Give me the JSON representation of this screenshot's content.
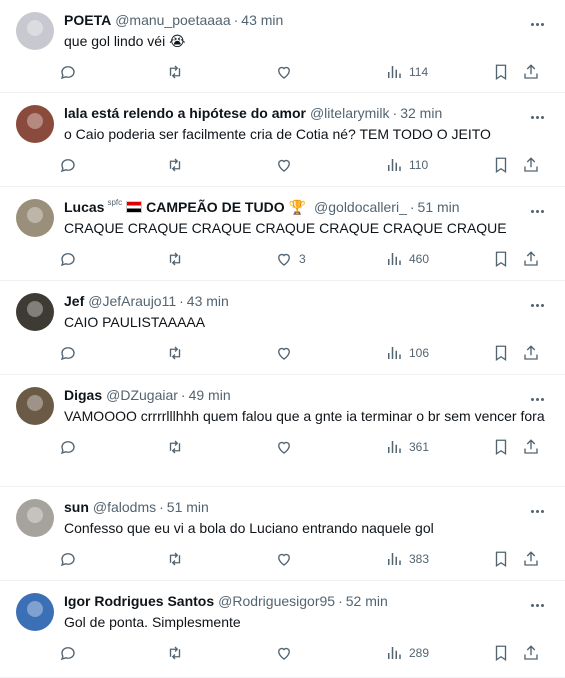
{
  "tweets": [
    {
      "name": "POETA",
      "handle": "@manu_poetaaaa",
      "time": "43 min",
      "text": "que gol lindo véi 😭",
      "replies": "",
      "retweets": "",
      "likes": "",
      "views": "114",
      "avatar_color": "#c8c8d0"
    },
    {
      "name": "lala está relendo a hipótese do amor",
      "handle": "@litelarymilk",
      "time": "32 min",
      "text": "o Caio poderia ser facilmente cria de Cotia né? TEM TODO O JEITO",
      "replies": "",
      "retweets": "",
      "likes": "",
      "views": "110",
      "avatar_color": "#8a4a3c"
    },
    {
      "name": "Lucas",
      "name_sup": "spfc",
      "name_suffix": "CAMPEÃO DE TUDO",
      "handle": "@goldocalleri_",
      "time": "51 min",
      "text": "CRAQUE CRAQUE CRAQUE CRAQUE CRAQUE CRAQUE CRAQUE",
      "replies": "",
      "retweets": "",
      "likes": "3",
      "views": "460",
      "avatar_color": "#9a8f7a"
    },
    {
      "name": "Jef",
      "handle": "@JefAraujo11",
      "time": "43 min",
      "text": "CAIO PAULISTAAAAA",
      "replies": "",
      "retweets": "",
      "likes": "",
      "views": "106",
      "avatar_color": "#3d3b33"
    },
    {
      "name": "Digas",
      "handle": "@DZugaiar",
      "time": "49 min",
      "text": "VAMOOOO crrrrlllhhh quem falou que a gnte ia terminar o br sem vencer fora",
      "replies": "",
      "retweets": "",
      "likes": "",
      "views": "361",
      "avatar_color": "#6b5a45"
    },
    {
      "name": "sun",
      "handle": "@falodms",
      "time": "51 min",
      "text": "Confesso que eu vi a bola do Luciano entrando naquele gol",
      "replies": "",
      "retweets": "",
      "likes": "",
      "views": "383",
      "avatar_color": "#a6a39c"
    },
    {
      "name": "Igor Rodrigues Santos",
      "handle": "@Rodriguesigor95",
      "time": "52 min",
      "text": "Gol de ponta. Simplesmente",
      "replies": "",
      "retweets": "",
      "likes": "",
      "views": "289",
      "avatar_color": "#3b6fb6"
    }
  ]
}
